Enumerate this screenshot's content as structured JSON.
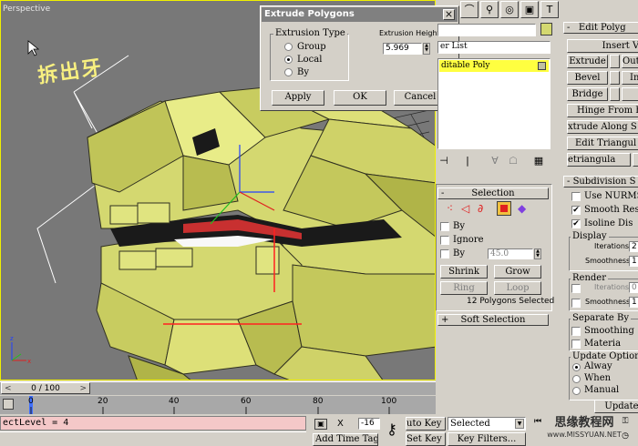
{
  "viewport": {
    "label": "Perspective",
    "annotation": "拆出牙"
  },
  "extrude_dialog": {
    "title": "Extrude Polygons",
    "close": "×",
    "extrusion_type_label": "Extrusion Type",
    "options": [
      "Group",
      "Local",
      "By"
    ],
    "selected_option": "Local",
    "height_label": "Extrusion Height:",
    "height_value": "5.969",
    "apply": "Apply",
    "ok": "OK",
    "cancel": "Cancel"
  },
  "modifier_stack": {
    "list_label": "er List",
    "item": "ditable Poly"
  },
  "edit_polygons": {
    "title": "Edit Polyg",
    "insert": "Insert Ver",
    "extrude": "Extrude",
    "outline": "Out",
    "bevel": "Bevel",
    "inset": "In",
    "bridge": "Bridge",
    "hinge": "Hinge From E",
    "extrude_along": "xtrude Along S",
    "edit_triang": "Edit Triangul",
    "retriang": "etriangula"
  },
  "selection": {
    "title": "Selection",
    "by_vertex": "By",
    "ignore": "Ignore",
    "by_angle": "By",
    "angle_value": "45.0",
    "shrink": "Shrink",
    "grow": "Grow",
    "ring": "Ring",
    "loop": "Loop",
    "status": "12 Polygons Selected",
    "soft_selection": "Soft Selection"
  },
  "subdivision": {
    "title": "Subdivision S",
    "use_nurms": "Use NURMS",
    "smooth_result": "Smooth Resu",
    "isoline": "Isoline Dis",
    "display": "Display",
    "iterations_label": "Iterations:",
    "iterations_value": "2",
    "smoothness_label": "Smoothness:",
    "smoothness_value": "1",
    "render": "Render",
    "r_iterations_value": "0",
    "r_smoothness_value": "1",
    "separate_by": "Separate By",
    "smoothing": "Smoothing",
    "material": "Materia",
    "update_options": "Update Option",
    "always": "Alway",
    "when": "When",
    "manual": "Manual",
    "update_btn": "Update"
  },
  "timeline": {
    "frame": "0 / 100",
    "ticks": [
      "0",
      "20",
      "40",
      "60",
      "80",
      "100"
    ]
  },
  "status": {
    "maxscript": "ectLevel = 4",
    "x_label": "X",
    "x_value": "-16",
    "add_time_tag": "Add Time Tag",
    "auto_key": "uto Key",
    "set_key": "Set Key",
    "selected": "Selected",
    "key_filters": "Key Filters...",
    "watermark_cn": "思缘教程网",
    "watermark_url": "www.MISSYUAN.NET"
  },
  "colors": {
    "viewport_bg": "#787878",
    "mesh": "#d4d870",
    "highlight_row": "#ffff40",
    "maxscript_bg": "#f4c8c8",
    "timeline_bg": "#a8a8a8"
  }
}
